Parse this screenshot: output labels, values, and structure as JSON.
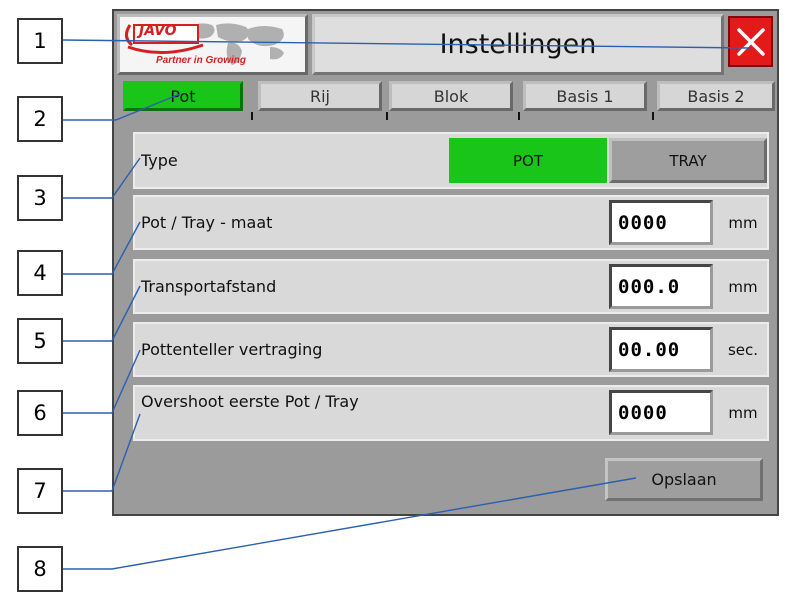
{
  "callouts": [
    "1",
    "2",
    "3",
    "4",
    "5",
    "6",
    "7",
    "8"
  ],
  "logo": {
    "brand": "JAVO",
    "tagline": "Partner in Growing"
  },
  "window": {
    "title": "Instellingen",
    "close_icon": "close-x-icon"
  },
  "tabs": [
    {
      "label": "Pot",
      "active": true
    },
    {
      "label": "Rij",
      "active": false
    },
    {
      "label": "Blok",
      "active": false
    },
    {
      "label": "Basis 1",
      "active": false
    },
    {
      "label": "Basis 2",
      "active": false
    }
  ],
  "settings": {
    "type": {
      "label": "Type",
      "options": [
        {
          "label": "POT",
          "selected": true
        },
        {
          "label": "TRAY",
          "selected": false
        }
      ]
    },
    "pot_size": {
      "label": "Pot / Tray - maat",
      "value": "0000",
      "unit": "mm"
    },
    "transport": {
      "label": "Transportafstand",
      "value": "000.0",
      "unit": "mm"
    },
    "counter_delay": {
      "label": "Pottenteller vertraging",
      "value": "00.00",
      "unit": "sec."
    },
    "overshoot": {
      "label": "Overshoot eerste Pot / Tray",
      "value": "0000",
      "unit": "mm"
    }
  },
  "actions": {
    "save_label": "Opslaan"
  },
  "colors": {
    "active_green": "#19c519",
    "close_red": "#e21a1a",
    "panel_gray": "#9b9b9b",
    "leader_blue": "#2b5fb0"
  }
}
